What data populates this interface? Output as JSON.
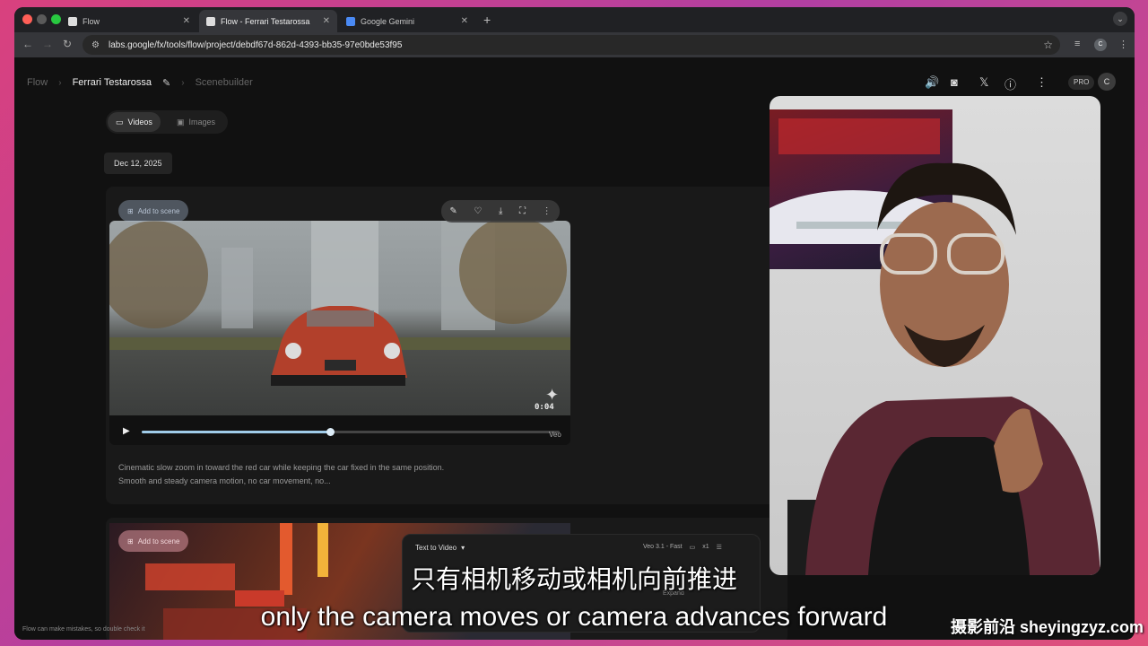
{
  "browser": {
    "tabs": [
      {
        "title": "Flow",
        "active": false
      },
      {
        "title": "Flow - Ferrari Testarossa",
        "active": true
      },
      {
        "title": "Google Gemini",
        "active": false
      }
    ],
    "url": "labs.google/fx/tools/flow/project/debdf67d-862d-4393-bb35-97e0bde53f95",
    "profile_initial": "C"
  },
  "header": {
    "breadcrumb_root": "Flow",
    "project_name": "Ferrari Testarossa",
    "section": "Scenebuilder",
    "pro_badge": "PRO",
    "avatar_initial": "C"
  },
  "media_toggle": {
    "videos_label": "Videos",
    "images_label": "Images"
  },
  "date_chip": "Dec 12, 2025",
  "clip1": {
    "add_to_scene": "Add to scene",
    "timestamp": "0:04",
    "progress": 0.45,
    "model_label": "Veo",
    "prompt": "Cinematic slow zoom in toward the red car while keeping the car fixed in the same position. Smooth and steady camera motion, no car movement, no..."
  },
  "clip2": {
    "add_to_scene": "Add to scene"
  },
  "composer": {
    "mode": "Text to Video",
    "model": "Veo 3.1 - Fast",
    "count": "x1",
    "expand": "Expand"
  },
  "footer_note": "Flow can make mistakes, so double check it",
  "subtitles": {
    "chinese": "只有相机移动或相机向前推进",
    "english": "only the camera moves or camera advances forward"
  },
  "watermark": "摄影前沿 sheyingzyz.com",
  "colors": {
    "accent": "#9fcbe8",
    "background": "#111111"
  }
}
